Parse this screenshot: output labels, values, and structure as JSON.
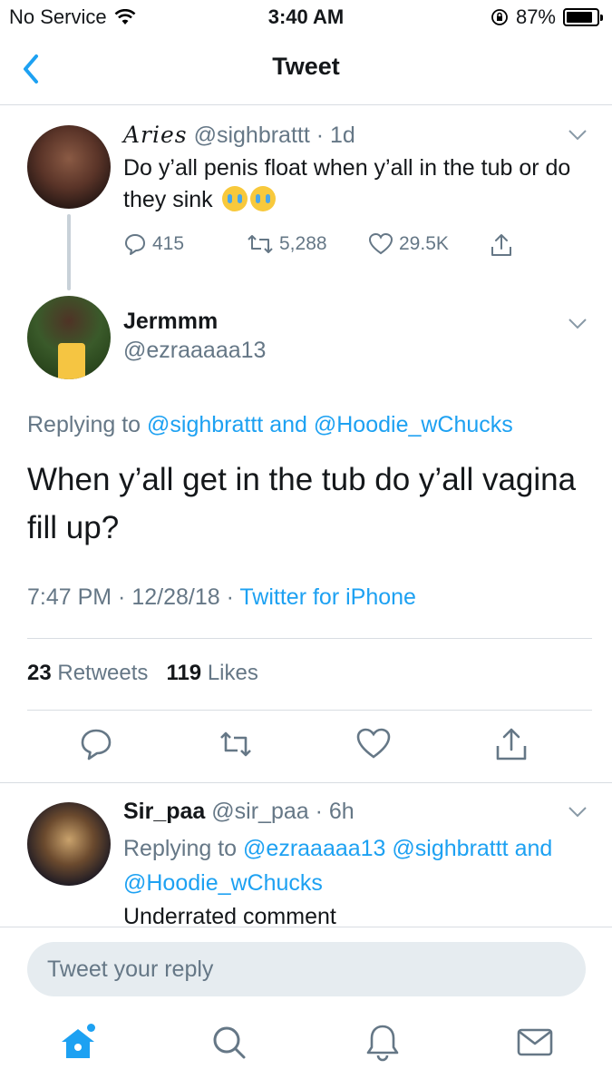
{
  "status_bar": {
    "carrier": "No Service",
    "time": "3:40 AM",
    "battery": "87%",
    "battery_level": 0.87
  },
  "nav": {
    "title": "Tweet"
  },
  "parent_tweet": {
    "display_name": "Aries",
    "handle": "@sighbrattt",
    "age": "· 1d",
    "text": "Do y’all penis float when y’all in the tub or do they sink",
    "replies": "415",
    "retweets": "5,288",
    "likes": "29.5K"
  },
  "main_tweet": {
    "display_name": "Jermmm",
    "handle": "@ezraaaaa13",
    "replying_label": "Replying to",
    "replying_to_1": "@sighbrattt",
    "replying_joiner": "and",
    "replying_to_2": "@Hoodie_wChucks",
    "text": "When y’all get in the tub do y’all vagina fill up?",
    "timestamp": "7:47 PM · 12/28/18 ·",
    "source": "Twitter for iPhone",
    "retweet_count": "23",
    "retweet_label": "Retweets",
    "like_count": "119",
    "like_label": "Likes"
  },
  "reply_tweet": {
    "display_name": "Sir_paa",
    "handle": "@sir_paa",
    "age": "· 6h",
    "replying_label": "Replying to",
    "replying_to_1": "@ezraaaaa13",
    "replying_to_2": "@sighbrattt",
    "replying_joiner": "and",
    "replying_to_3": "@Hoodie_wChucks",
    "text": "Underrated comment"
  },
  "composer": {
    "placeholder": "Tweet your reply"
  },
  "tabs": [
    "home-icon",
    "search-icon",
    "notifications-icon",
    "messages-icon"
  ],
  "colors": {
    "accent": "#1da1f2",
    "muted": "#657786",
    "text": "#14171a",
    "divider": "#d8dde2",
    "input_bg": "#e6ecf0"
  }
}
